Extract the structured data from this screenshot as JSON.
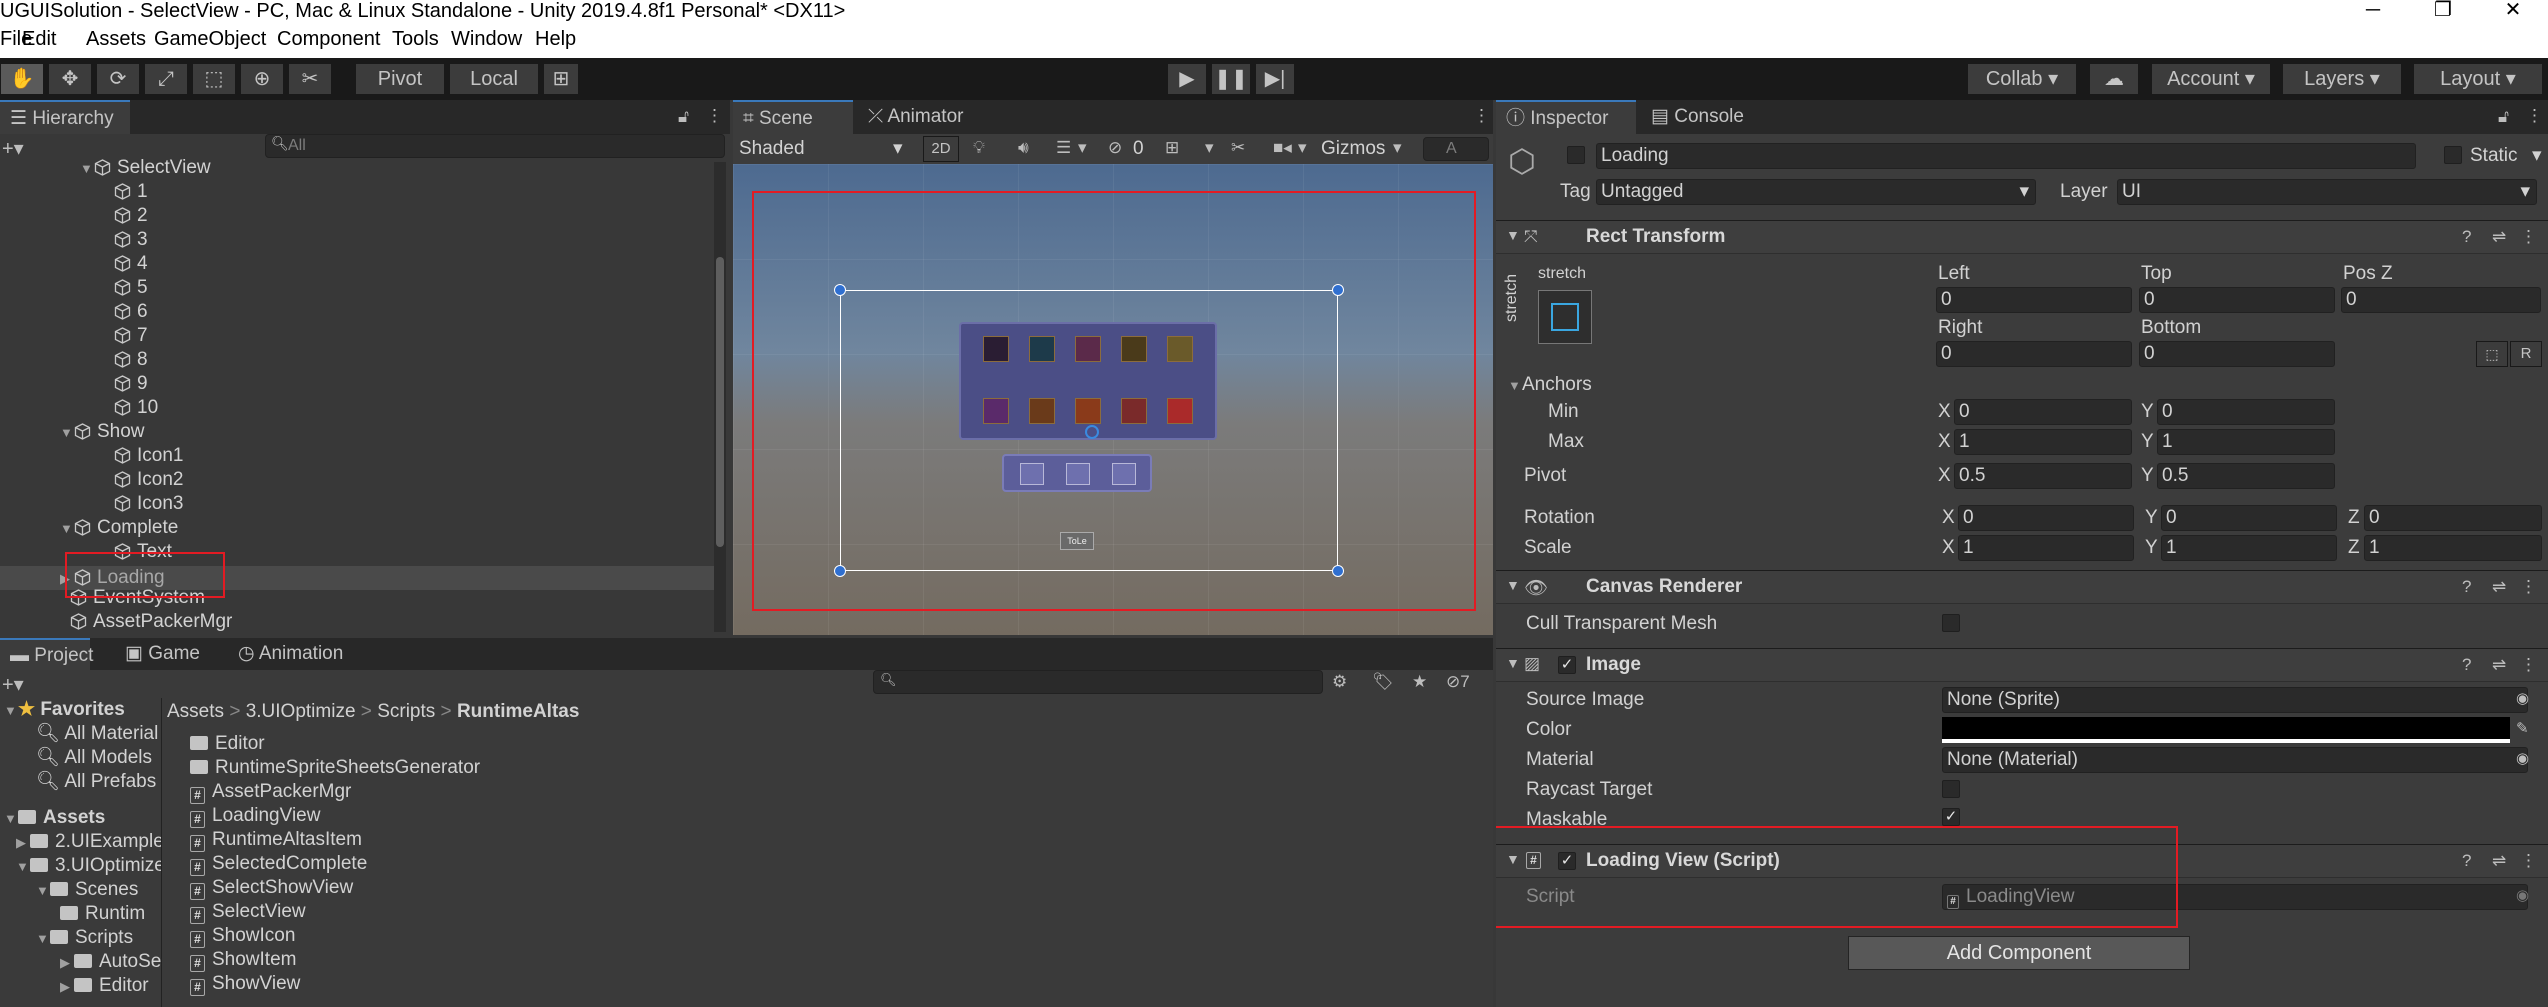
{
  "window": {
    "title": "UGUISolution - SelectView - PC, Mac & Linux Standalone - Unity 2019.4.8f1 Personal* <DX11>"
  },
  "menu": [
    "File",
    "Edit",
    "Assets",
    "GameObject",
    "Component",
    "Tools",
    "Window",
    "Help"
  ],
  "toolbar": {
    "pivot": "Pivot",
    "local": "Local",
    "collab": "Collab",
    "account": "Account",
    "layers": "Layers",
    "layout": "Layout"
  },
  "hierarchy": {
    "tab": "Hierarchy",
    "search_placeholder": "All",
    "items": [
      {
        "label": "SelectView"
      },
      {
        "label": "1"
      },
      {
        "label": "2"
      },
      {
        "label": "3"
      },
      {
        "label": "4"
      },
      {
        "label": "5"
      },
      {
        "label": "6"
      },
      {
        "label": "7"
      },
      {
        "label": "8"
      },
      {
        "label": "9"
      },
      {
        "label": "10"
      },
      {
        "label": "Show"
      },
      {
        "label": "Icon1"
      },
      {
        "label": "Icon2"
      },
      {
        "label": "Icon3"
      },
      {
        "label": "Complete"
      },
      {
        "label": "Text"
      },
      {
        "label": "Loading"
      },
      {
        "label": "EventSystem"
      },
      {
        "label": "AssetPackerMgr"
      }
    ]
  },
  "scene": {
    "tab_scene": "Scene",
    "tab_animator": "Animator",
    "shading": "Shaded",
    "mode2d": "2D",
    "hidden_count": "0",
    "gizmos": "Gizmos",
    "search_placeholder": "A",
    "text_label": "ToLe"
  },
  "project": {
    "tab_project": "Project",
    "tab_game": "Game",
    "tab_animation": "Animation",
    "hidden_count": "7",
    "favorites": {
      "label": "Favorites",
      "items": [
        "All Material",
        "All Models",
        "All Prefabs"
      ]
    },
    "assets": {
      "label": "Assets",
      "items": [
        "2.UIExample",
        "3.UIOptimize",
        "Scenes",
        "Runtim",
        "Scripts",
        "AutoSe",
        "Editor"
      ]
    },
    "breadcrumb": [
      "Assets",
      "3.UIOptimize",
      "Scripts",
      "RuntimeAltas"
    ],
    "folders": [
      "Editor",
      "RuntimeSpriteSheetsGenerator"
    ],
    "scripts": [
      "AssetPackerMgr",
      "LoadingView",
      "RuntimeAltasItem",
      "SelectedComplete",
      "SelectShowView",
      "SelectView",
      "ShowIcon",
      "ShowItem",
      "ShowView"
    ]
  },
  "inspector": {
    "tab_inspector": "Inspector",
    "tab_console": "Console",
    "object_name": "Loading",
    "static_label": "Static",
    "tag_label": "Tag",
    "tag_value": "Untagged",
    "layer_label": "Layer",
    "layer_value": "UI",
    "rect": {
      "title": "Rect Transform",
      "stretch_label": "stretch",
      "left": "Left",
      "top": "Top",
      "posz": "Pos Z",
      "right": "Right",
      "bottom": "Bottom",
      "left_val": "0",
      "top_val": "0",
      "posz_val": "0",
      "right_val": "0",
      "bottom_val": "0",
      "anchors": "Anchors",
      "min": "Min",
      "max": "Max",
      "min_x": "0",
      "min_y": "0",
      "max_x": "1",
      "max_y": "1",
      "pivot": "Pivot",
      "pivot_x": "0.5",
      "pivot_y": "0.5",
      "rotation": "Rotation",
      "rot_x": "0",
      "rot_y": "0",
      "rot_z": "0",
      "scale": "Scale",
      "scale_x": "1",
      "scale_y": "1",
      "scale_z": "1",
      "r_btn": "R"
    },
    "canvas": {
      "title": "Canvas Renderer",
      "cull": "Cull Transparent Mesh"
    },
    "image": {
      "title": "Image",
      "source": "Source Image",
      "source_val": "None (Sprite)",
      "color": "Color",
      "material": "Material",
      "material_val": "None (Material)",
      "raycast": "Raycast Target",
      "maskable": "Maskable"
    },
    "script": {
      "title": "Loading View (Script)",
      "script_label": "Script",
      "script_val": "LoadingView"
    },
    "add_component": "Add Component"
  },
  "axis_labels": {
    "x": "X",
    "y": "Y",
    "z": "Z"
  },
  "colors": {
    "accent": "#3a79bb",
    "highlight_red": "#e31b23"
  }
}
